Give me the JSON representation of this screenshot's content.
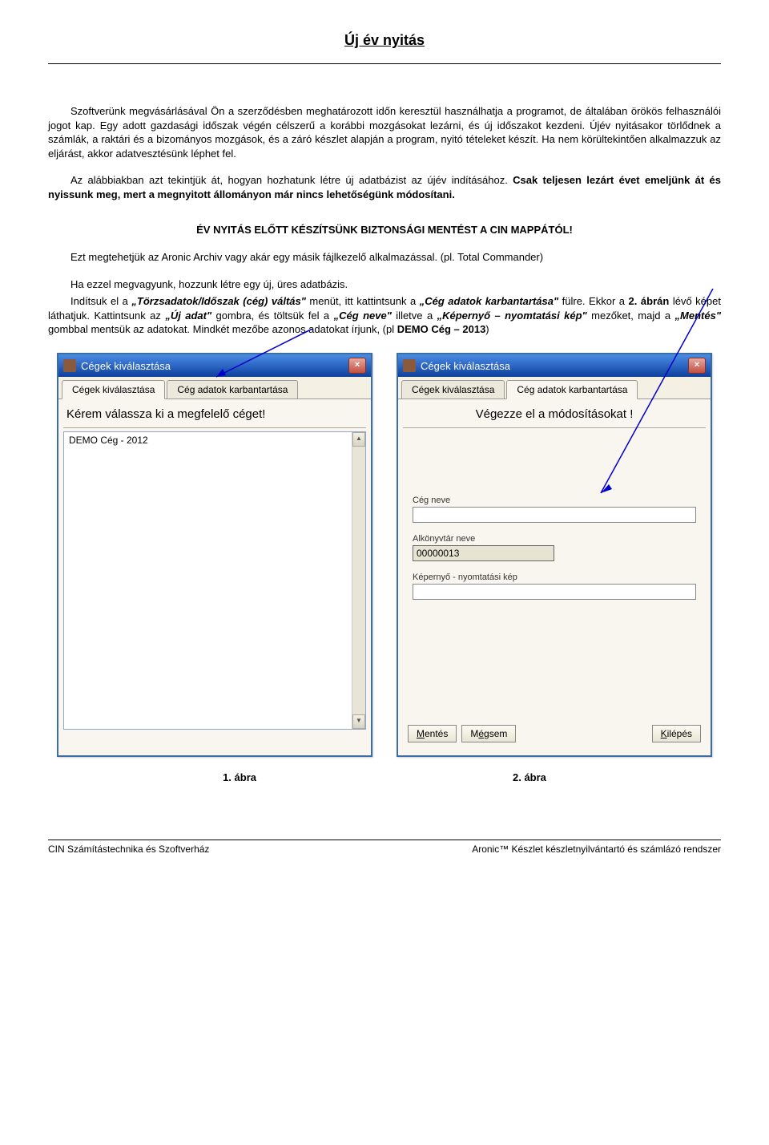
{
  "page": {
    "title": "Új év nyitás"
  },
  "paragraphs": {
    "p1": "Szoftverünk megvásárlásával Ön a szerződésben meghatározott időn keresztül használhatja a programot, de általában örökös felhasználói jogot kap. Egy adott gazdasági időszak végén célszerű a korábbi mozgásokat lezárni, és új időszakot kezdeni. Újév nyitásakor törlődnek a számlák, a raktári és a bizományos mozgások, és a záró készlet alapján a program, nyitó tételeket készít. Ha nem körültekintően alkalmazzuk az eljárást, akkor adatvesztésünk léphet fel.",
    "p2a": "Az alábbiakban azt tekintjük át, hogyan hozhatunk létre új adatbázist az újév indításához. ",
    "p2b": "Csak teljesen lezárt évet emeljünk át és nyissunk meg, mert a megnyitott állományon már nincs lehetőségünk módosítani.",
    "section_head": "ÉV NYITÁS ELŐTT KÉSZÍTSÜNK BIZTONSÁGI MENTÉST A CIN MAPPÁTÓL!",
    "p3": "Ezt megtehetjük az Aronic Archiv vagy akár egy másik fájlkezelő alkalmazással. (pl. Total Commander)",
    "p4": "Ha ezzel megvagyunk, hozzunk létre egy új, üres adatbázis.",
    "p5_pre": "Indítsuk el a ",
    "p5_b1": "„Törzsadatok/Időszak (cég) váltás\"",
    "p5_mid": " menüt, itt kattintsunk a ",
    "p5_b2": "„Cég adatok karbantartása\"",
    "p5_post": " fülre. Ekkor a ",
    "p5_b3": "2. ábrán",
    "p5_post2": " lévő képet láthatjuk. Kattintsunk az ",
    "p5_b4": "„Új adat\"",
    "p5_post3": " gombra, és töltsük fel a ",
    "p5_b5": "„Cég neve\"",
    "p5_post4": " illetve a ",
    "p5_b6": "„Képernyő – nyomtatási kép\"",
    "p5_post5": " mezőket, majd a ",
    "p5_b7": "„Mentés\"",
    "p5_post6": " gombbal mentsük az adatokat. Mindkét mezőbe azonos adatokat írjunk, (pl ",
    "p5_b8": "DEMO Cég – 2013",
    "p5_post7": ")"
  },
  "dialog1": {
    "title": "Cégek kiválasztása",
    "tab1": "Cégek kiválasztása",
    "tab2": "Cég adatok karbantartása",
    "prompt": "Kérem válassza ki a megfelelő céget!",
    "list_item": "DEMO Cég - 2012"
  },
  "dialog2": {
    "title": "Cégek kiválasztása",
    "tab1": "Cégek kiválasztása",
    "tab2": "Cég adatok karbantartása",
    "prompt": "Végezze el a módosításokat !",
    "label1": "Cég neve",
    "value1": "",
    "label2": "Alkönyvtár neve",
    "value2": "00000013",
    "label3": "Képernyő - nyomtatási kép",
    "value3": "",
    "btn_save": "Mentés",
    "btn_cancel": "Mégsem",
    "btn_exit": "Kilépés"
  },
  "captions": {
    "fig1": "1. ábra",
    "fig2": "2. ábra"
  },
  "footer": {
    "left": "CIN Számítástechnika és Szoftverház",
    "right": "Aronic™ Készlet készletnyilvántartó és számlázó rendszer"
  }
}
